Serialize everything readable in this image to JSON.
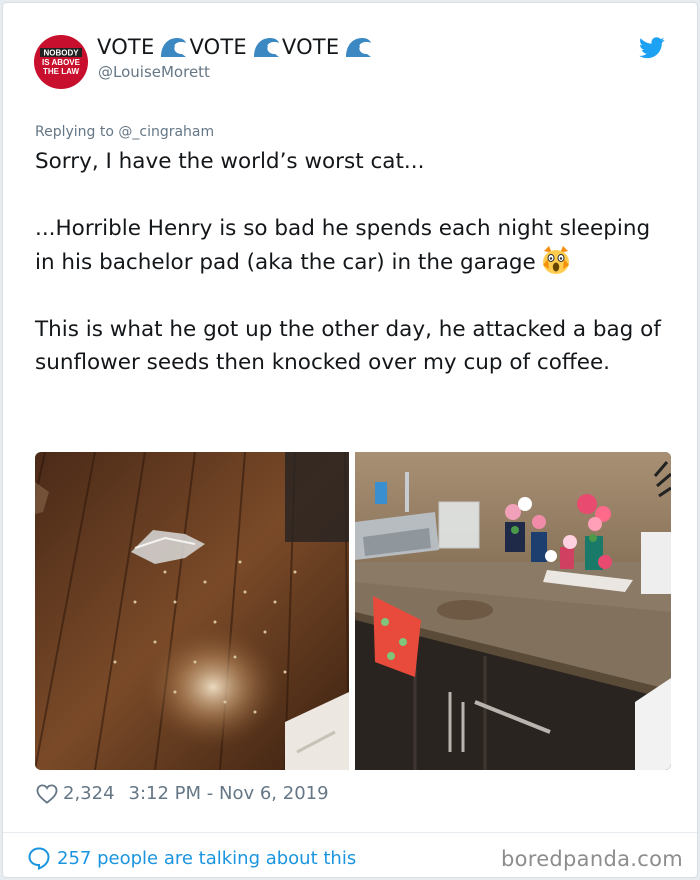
{
  "tweet": {
    "author": {
      "name_words": [
        "VOTE",
        "VOTE",
        "VOTE"
      ],
      "handle": "@LouiseMorett",
      "avatar_text": [
        "NOBODY",
        "IS ABOVE",
        "THE LAW"
      ],
      "avatar_color": "#c8102e"
    },
    "replying_to": "Replying to @_cingraham",
    "paragraph1": "Sorry, I have the world’s worst cat...",
    "paragraph2": "...Horrible Henry is so bad he spends each night sleeping in his bachelor pad (aka the car) in the garage",
    "paragraph3": "This is what he got up the other day, he attacked a bag of sunflower seeds then knocked over my cup of coffee.",
    "likes": "2,324",
    "timestamp": "3:12 PM - Nov 6, 2019",
    "talking": "257 people are talking about this",
    "icons": {
      "name_emoji": "water-wave-icon",
      "text_emoji": "screaming-cat-icon",
      "brand": "twitter-bird-icon",
      "like": "heart-icon",
      "reply": "speech-bubble-icon"
    },
    "colors": {
      "link": "#1b95e0",
      "secondary": "#657786",
      "text": "#14171a"
    }
  },
  "watermark": "boredpanda.com"
}
